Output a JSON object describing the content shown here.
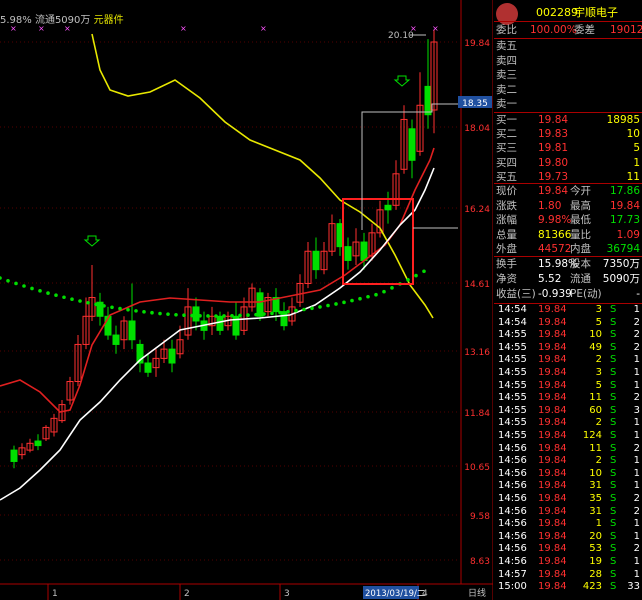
{
  "header": {
    "prefix": "5.98% 流通5090万",
    "sector": "元器件",
    "peak_label": "20.10"
  },
  "price_axis": {
    "labels": [
      "19.84",
      "18.04",
      "16.24",
      "14.61",
      "13.16",
      "11.84",
      "10.65",
      "9.58",
      "8.63"
    ],
    "current_tag": "18.35"
  },
  "date_axis": {
    "labels": [
      "1",
      "2",
      "3",
      "4"
    ],
    "date_tag": "2013/03/19/二",
    "mode_label": "日线"
  },
  "stock": {
    "code": "002289",
    "name": "宇顺电子",
    "wei_bi_label": "委比",
    "wei_bi": "100.00%",
    "wei_cha_label": "委差",
    "wei_cha": "19012"
  },
  "sell_orders": [
    {
      "label": "卖五",
      "price": "",
      "vol": ""
    },
    {
      "label": "卖四",
      "price": "",
      "vol": ""
    },
    {
      "label": "卖三",
      "price": "",
      "vol": ""
    },
    {
      "label": "卖二",
      "price": "",
      "vol": ""
    },
    {
      "label": "卖一",
      "price": "",
      "vol": ""
    }
  ],
  "buy_orders": [
    {
      "label": "买一",
      "price": "19.84",
      "vol": "18985"
    },
    {
      "label": "买二",
      "price": "19.83",
      "vol": "10"
    },
    {
      "label": "买三",
      "price": "19.81",
      "vol": "5"
    },
    {
      "label": "买四",
      "price": "19.80",
      "vol": "1"
    },
    {
      "label": "买五",
      "price": "19.73",
      "vol": "11"
    }
  ],
  "quote": [
    {
      "l1": "现价",
      "v1": "19.84",
      "c1": "red",
      "l2": "今开",
      "v2": "17.86",
      "c2": "green"
    },
    {
      "l1": "涨跌",
      "v1": "1.80",
      "c1": "red",
      "l2": "最高",
      "v2": "19.84",
      "c2": "red"
    },
    {
      "l1": "涨幅",
      "v1": "9.98%",
      "c1": "red",
      "l2": "最低",
      "v2": "17.73",
      "c2": "green"
    },
    {
      "l1": "总量",
      "v1": "81366",
      "c1": "yellow",
      "l2": "量比",
      "v2": "1.09",
      "c2": "red"
    },
    {
      "l1": "外盘",
      "v1": "44572",
      "c1": "red",
      "l2": "内盘",
      "v2": "36794",
      "c2": "green"
    }
  ],
  "fundamentals": [
    {
      "l1": "换手",
      "v1": "15.98%",
      "l2": "股本",
      "v2": "7350万"
    },
    {
      "l1": "净资",
      "v1": "5.52",
      "l2": "流通",
      "v2": "5090万"
    },
    {
      "l1": "收益(三)",
      "v1": "-0.939",
      "l2": "PE(动)",
      "v2": "-"
    }
  ],
  "ticks": [
    {
      "time": "14:54",
      "price": "19.84",
      "vol": "3",
      "bs": "S",
      "n": "1"
    },
    {
      "time": "14:54",
      "price": "19.84",
      "vol": "5",
      "bs": "S",
      "n": "2"
    },
    {
      "time": "14:55",
      "price": "19.84",
      "vol": "10",
      "bs": "S",
      "n": "2"
    },
    {
      "time": "14:55",
      "price": "19.84",
      "vol": "49",
      "bs": "S",
      "n": "2"
    },
    {
      "time": "14:55",
      "price": "19.84",
      "vol": "2",
      "bs": "S",
      "n": "1"
    },
    {
      "time": "14:55",
      "price": "19.84",
      "vol": "3",
      "bs": "S",
      "n": "1"
    },
    {
      "time": "14:55",
      "price": "19.84",
      "vol": "5",
      "bs": "S",
      "n": "1"
    },
    {
      "time": "14:55",
      "price": "19.84",
      "vol": "11",
      "bs": "S",
      "n": "2"
    },
    {
      "time": "14:55",
      "price": "19.84",
      "vol": "60",
      "bs": "S",
      "n": "3"
    },
    {
      "time": "14:55",
      "price": "19.84",
      "vol": "2",
      "bs": "S",
      "n": "1"
    },
    {
      "time": "14:55",
      "price": "19.84",
      "vol": "124",
      "bs": "S",
      "n": "1"
    },
    {
      "time": "14:56",
      "price": "19.84",
      "vol": "11",
      "bs": "S",
      "n": "2"
    },
    {
      "time": "14:56",
      "price": "19.84",
      "vol": "2",
      "bs": "S",
      "n": "1"
    },
    {
      "time": "14:56",
      "price": "19.84",
      "vol": "10",
      "bs": "S",
      "n": "1"
    },
    {
      "time": "14:56",
      "price": "19.84",
      "vol": "31",
      "bs": "S",
      "n": "1"
    },
    {
      "time": "14:56",
      "price": "19.84",
      "vol": "35",
      "bs": "S",
      "n": "2"
    },
    {
      "time": "14:56",
      "price": "19.84",
      "vol": "31",
      "bs": "S",
      "n": "2"
    },
    {
      "time": "14:56",
      "price": "19.84",
      "vol": "1",
      "bs": "S",
      "n": "1"
    },
    {
      "time": "14:56",
      "price": "19.84",
      "vol": "20",
      "bs": "S",
      "n": "1"
    },
    {
      "time": "14:56",
      "price": "19.84",
      "vol": "53",
      "bs": "S",
      "n": "2"
    },
    {
      "time": "14:56",
      "price": "19.84",
      "vol": "19",
      "bs": "S",
      "n": "1"
    },
    {
      "time": "14:57",
      "price": "19.84",
      "vol": "28",
      "bs": "S",
      "n": "1"
    },
    {
      "time": "15:00",
      "price": "19.84",
      "vol": "423",
      "bs": "S",
      "n": "33"
    }
  ],
  "colors": {
    "up": "#ff3030",
    "down": "#00e000",
    "ma_yellow": "#e8e800",
    "ma_red": "#e02020",
    "ma_white": "#ffffff",
    "dots": "#00dd00"
  }
}
